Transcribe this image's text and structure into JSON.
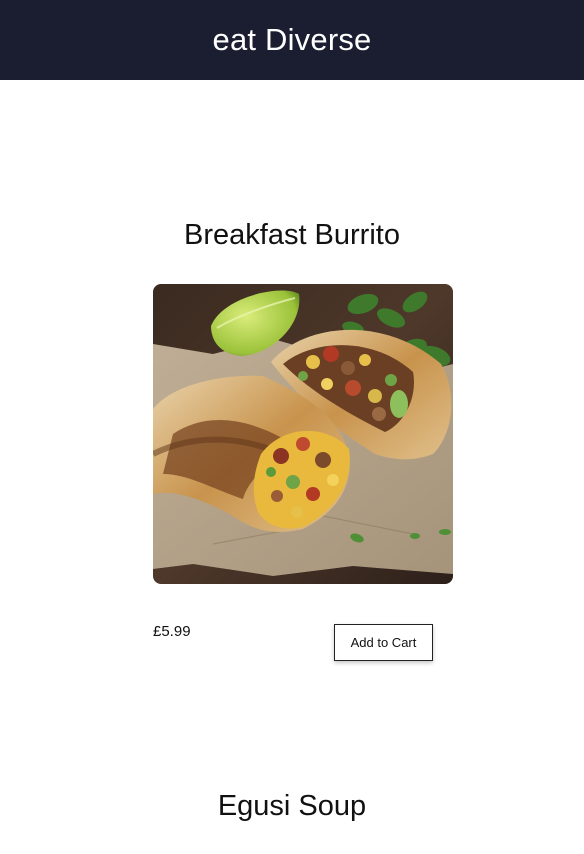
{
  "header": {
    "brand": "eat Diverse"
  },
  "menu": {
    "items": [
      {
        "title": "Breakfast Burrito",
        "image_alt": "Breakfast Burrito",
        "price": "£5.99",
        "cart_label": "Add to Cart"
      },
      {
        "title": "Egusi Soup"
      }
    ]
  },
  "colors": {
    "header_bg": "#1b1e30",
    "header_text": "#ffffff",
    "page_bg": "#ffffff"
  }
}
